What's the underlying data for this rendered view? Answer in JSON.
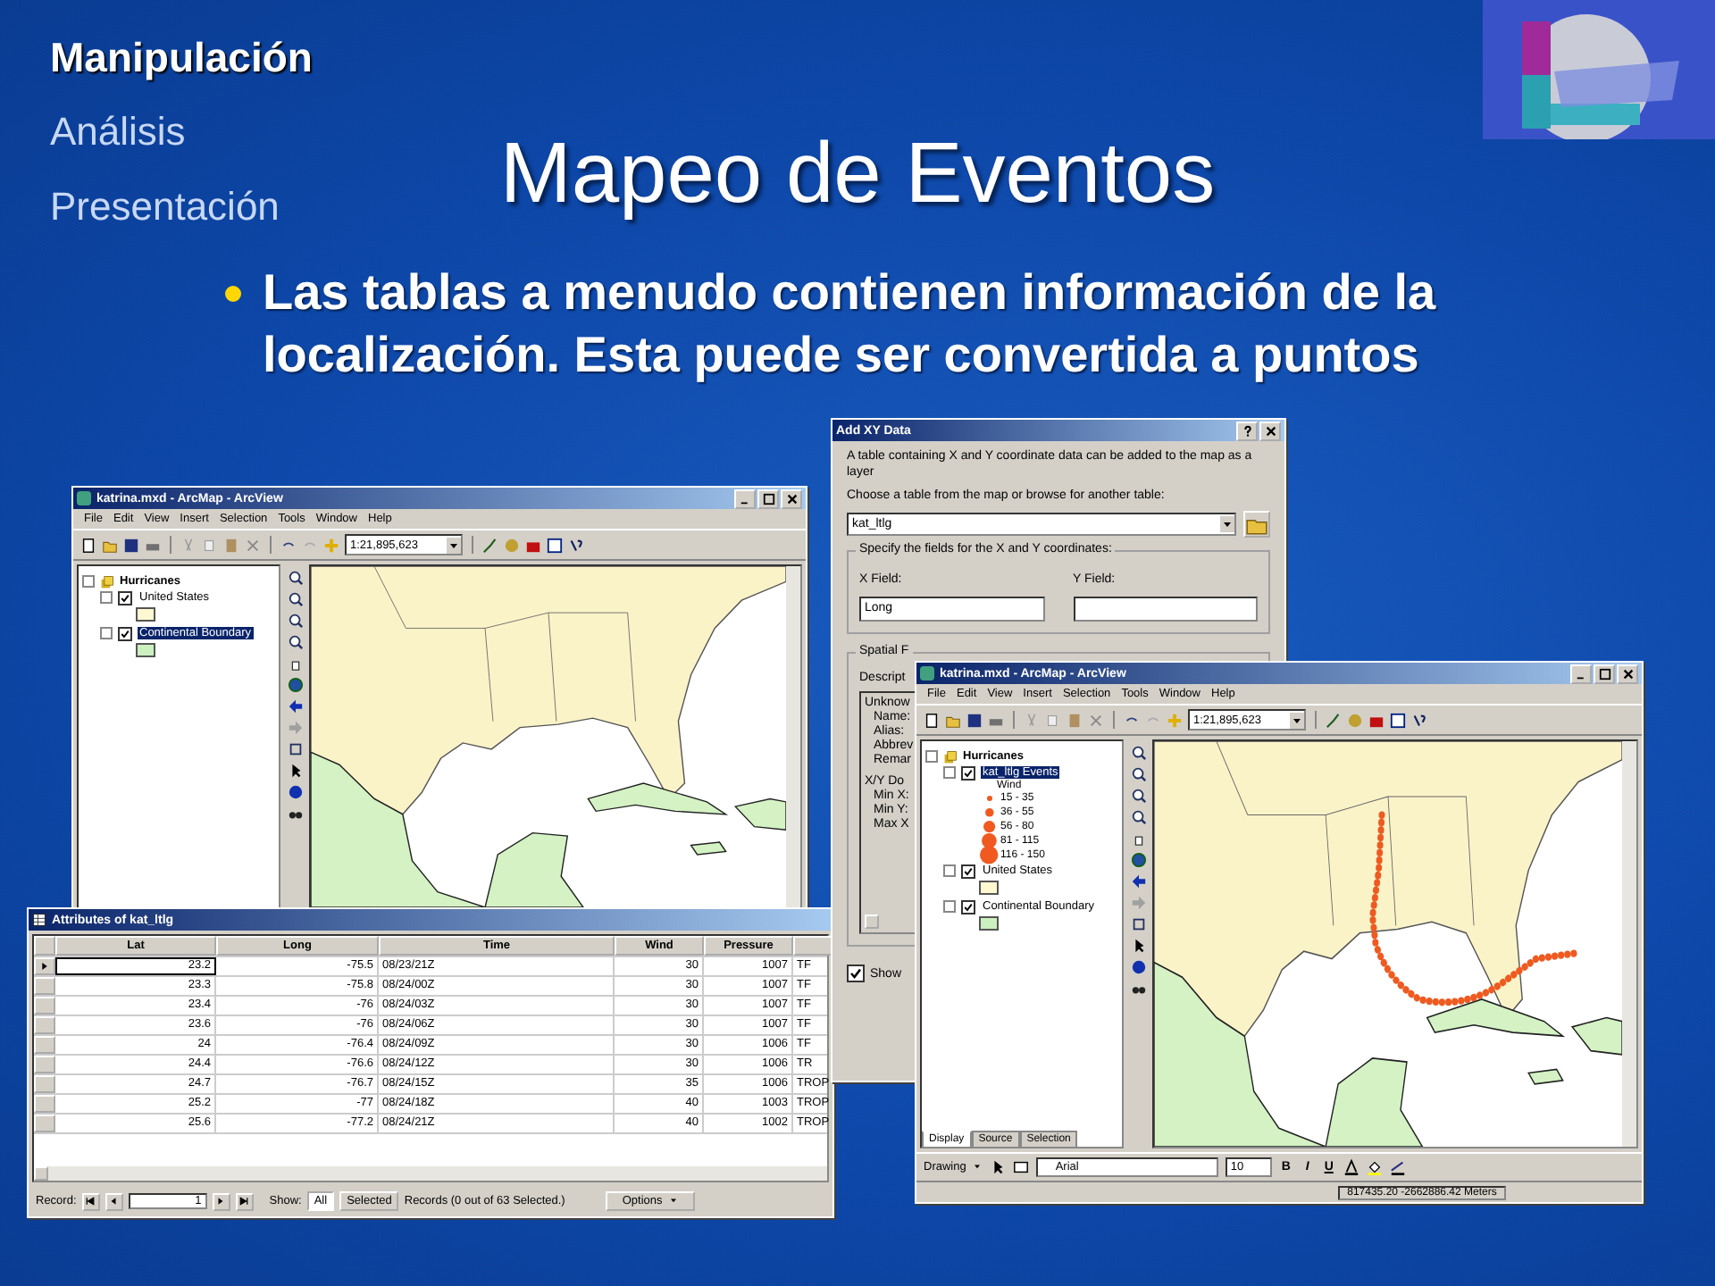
{
  "nav": [
    {
      "label": "Manipulación",
      "selected": true
    },
    {
      "label": "Análisis",
      "selected": false
    },
    {
      "label": "Presentación",
      "selected": false
    }
  ],
  "title": "Mapeo de Eventos",
  "bullets": [
    "Las tablas a menudo contienen información de la localización.  Esta puede ser convertida a puntos"
  ],
  "map_windows": [
    {
      "title": "katrina.mxd - ArcMap - ArcView",
      "menu": [
        "File",
        "Edit",
        "View",
        "Insert",
        "Selection",
        "Tools",
        "Window",
        "Help"
      ],
      "scale": "1:21,895,623",
      "track_shown": false,
      "toc": [
        {
          "label": "Hurricanes",
          "children": [
            {
              "label": "United States",
              "checked": true,
              "selected": false,
              "color": "#fff8d0"
            },
            {
              "label": "Continental Boundary",
              "checked": true,
              "selected": true,
              "color": "#ccf0c0"
            }
          ]
        }
      ]
    },
    {
      "title": "katrina.mxd - ArcMap - ArcView",
      "menu": [
        "File",
        "Edit",
        "View",
        "Insert",
        "Selection",
        "Tools",
        "Window",
        "Help"
      ],
      "scale": "1:21,895,623",
      "track_shown": true,
      "toc": [
        {
          "label": "Hurricanes",
          "children": [
            {
              "label": "kat_ltlg Events",
              "checked": true,
              "selected": true,
              "legend": {
                "title": "Wind",
                "classes": [
                  "15 - 35",
                  "36 - 55",
                  "56 - 80",
                  "81 - 115",
                  "116 - 150"
                ]
              }
            },
            {
              "label": "United States",
              "checked": true,
              "selected": false,
              "color": "#fff8d0"
            },
            {
              "label": "Continental Boundary",
              "checked": true,
              "selected": false,
              "color": "#ccf0c0"
            }
          ]
        }
      ],
      "tabs": [
        {
          "label": "Display",
          "selected": true
        },
        {
          "label": "Source",
          "selected": false
        },
        {
          "label": "Selection",
          "selected": false
        }
      ],
      "drawing_toolbar": {
        "label": "Drawing",
        "font": "Arial",
        "size": "10",
        "styles": [
          "B",
          "I",
          "U"
        ]
      },
      "status": "817435.20  -2662886.42 Meters"
    }
  ],
  "attributes": {
    "title": "Attributes of kat_ltlg",
    "columns": [
      "Lat",
      "Long",
      "Time",
      "Wind",
      "Pressure"
    ],
    "rows": [
      {
        "cells": [
          "23.2",
          "-75.5",
          "08/23/21Z",
          "30",
          "1007",
          "TF"
        ],
        "current": true
      },
      {
        "cells": [
          "23.3",
          "-75.8",
          "08/24/00Z",
          "30",
          "1007",
          "TF"
        ],
        "current": false
      },
      {
        "cells": [
          "23.4",
          "-76",
          "08/24/03Z",
          "30",
          "1007",
          "TF"
        ],
        "current": false
      },
      {
        "cells": [
          "23.6",
          "-76",
          "08/24/06Z",
          "30",
          "1007",
          "TF"
        ],
        "current": false
      },
      {
        "cells": [
          "24",
          "-76.4",
          "08/24/09Z",
          "30",
          "1006",
          "TF"
        ],
        "current": false
      },
      {
        "cells": [
          "24.4",
          "-76.6",
          "08/24/12Z",
          "30",
          "1006",
          "TR"
        ],
        "current": false
      },
      {
        "cells": [
          "24.7",
          "-76.7",
          "08/24/15Z",
          "35",
          "1006",
          "TROP"
        ],
        "current": false
      },
      {
        "cells": [
          "25.2",
          "-77",
          "08/24/18Z",
          "40",
          "1003",
          "TROP"
        ],
        "current": false
      },
      {
        "cells": [
          "25.6",
          "-77.2",
          "08/24/21Z",
          "40",
          "1002",
          "TROP"
        ],
        "current": false
      }
    ],
    "footer": {
      "record_label": "Record:",
      "record_value": "1",
      "show_label": "Show:",
      "show_options": [
        {
          "label": "All",
          "selected": true
        },
        {
          "label": "Selected",
          "selected": false
        }
      ],
      "records_text": "Records  (0 out of 63 Selected.)",
      "options": "Options"
    }
  },
  "xy_dialog": {
    "title": "Add XY Data",
    "intro": "A table containing X and Y coordinate data can be added to the map as a layer",
    "choose_label": "Choose a table from the map or browse for another table:",
    "table_value": "kat_ltlg",
    "fields_group": "Specify the fields for the X and Y coordinates:",
    "x_label": "X Field:",
    "x_value": "Long",
    "y_label": "Y Field:",
    "spatial_group": "Spatial F",
    "description_label": "Descript",
    "description_blocks": [
      {
        "heading": "Unknow",
        "lines": [
          "Name:",
          "Alias:",
          "Abbrev",
          "Remar"
        ]
      },
      {
        "heading": "X/Y Do",
        "lines": [
          "Min X:",
          "Min Y:",
          "Max X"
        ]
      }
    ],
    "show_label": "Show",
    "show_checked": true
  }
}
